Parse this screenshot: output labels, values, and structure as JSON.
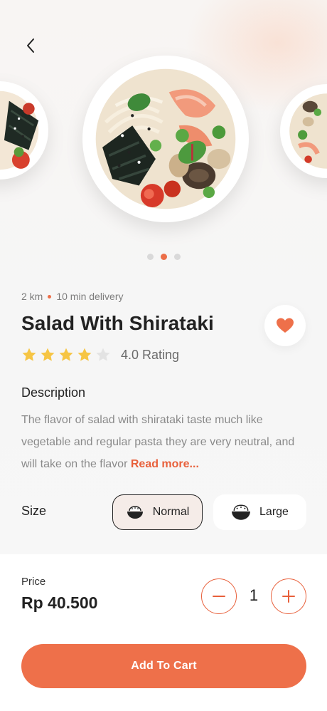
{
  "delivery": {
    "distance": "2 km",
    "time": "10 min delivery"
  },
  "product": {
    "title": "Salad With Shirataki",
    "rating": 4.0,
    "rating_text": "4.0 Rating",
    "stars_total": 5,
    "stars_filled": 4
  },
  "description": {
    "heading": "Description",
    "text": "The flavor of salad with shirataki taste much like vegetable and regular pasta they are very neutral, and will take on the flavor ",
    "read_more": "Read more..."
  },
  "size": {
    "label": "Size",
    "options": [
      {
        "label": "Normal",
        "selected": true
      },
      {
        "label": "Large",
        "selected": false
      }
    ]
  },
  "price": {
    "label": "Price",
    "value": "Rp 40.500"
  },
  "quantity": "1",
  "cart_button": "Add To Cart",
  "carousel": {
    "count": 3,
    "active_index": 1
  },
  "colors": {
    "accent": "#EC6E48",
    "star": "#F6C544",
    "star_empty": "#E3E3E3",
    "heart": "#EE704A"
  },
  "icons": {
    "back": "chevron-left-icon",
    "favorite": "heart-icon",
    "size": "rice-bowl-icon",
    "minus": "minus-icon",
    "plus": "plus-icon"
  }
}
